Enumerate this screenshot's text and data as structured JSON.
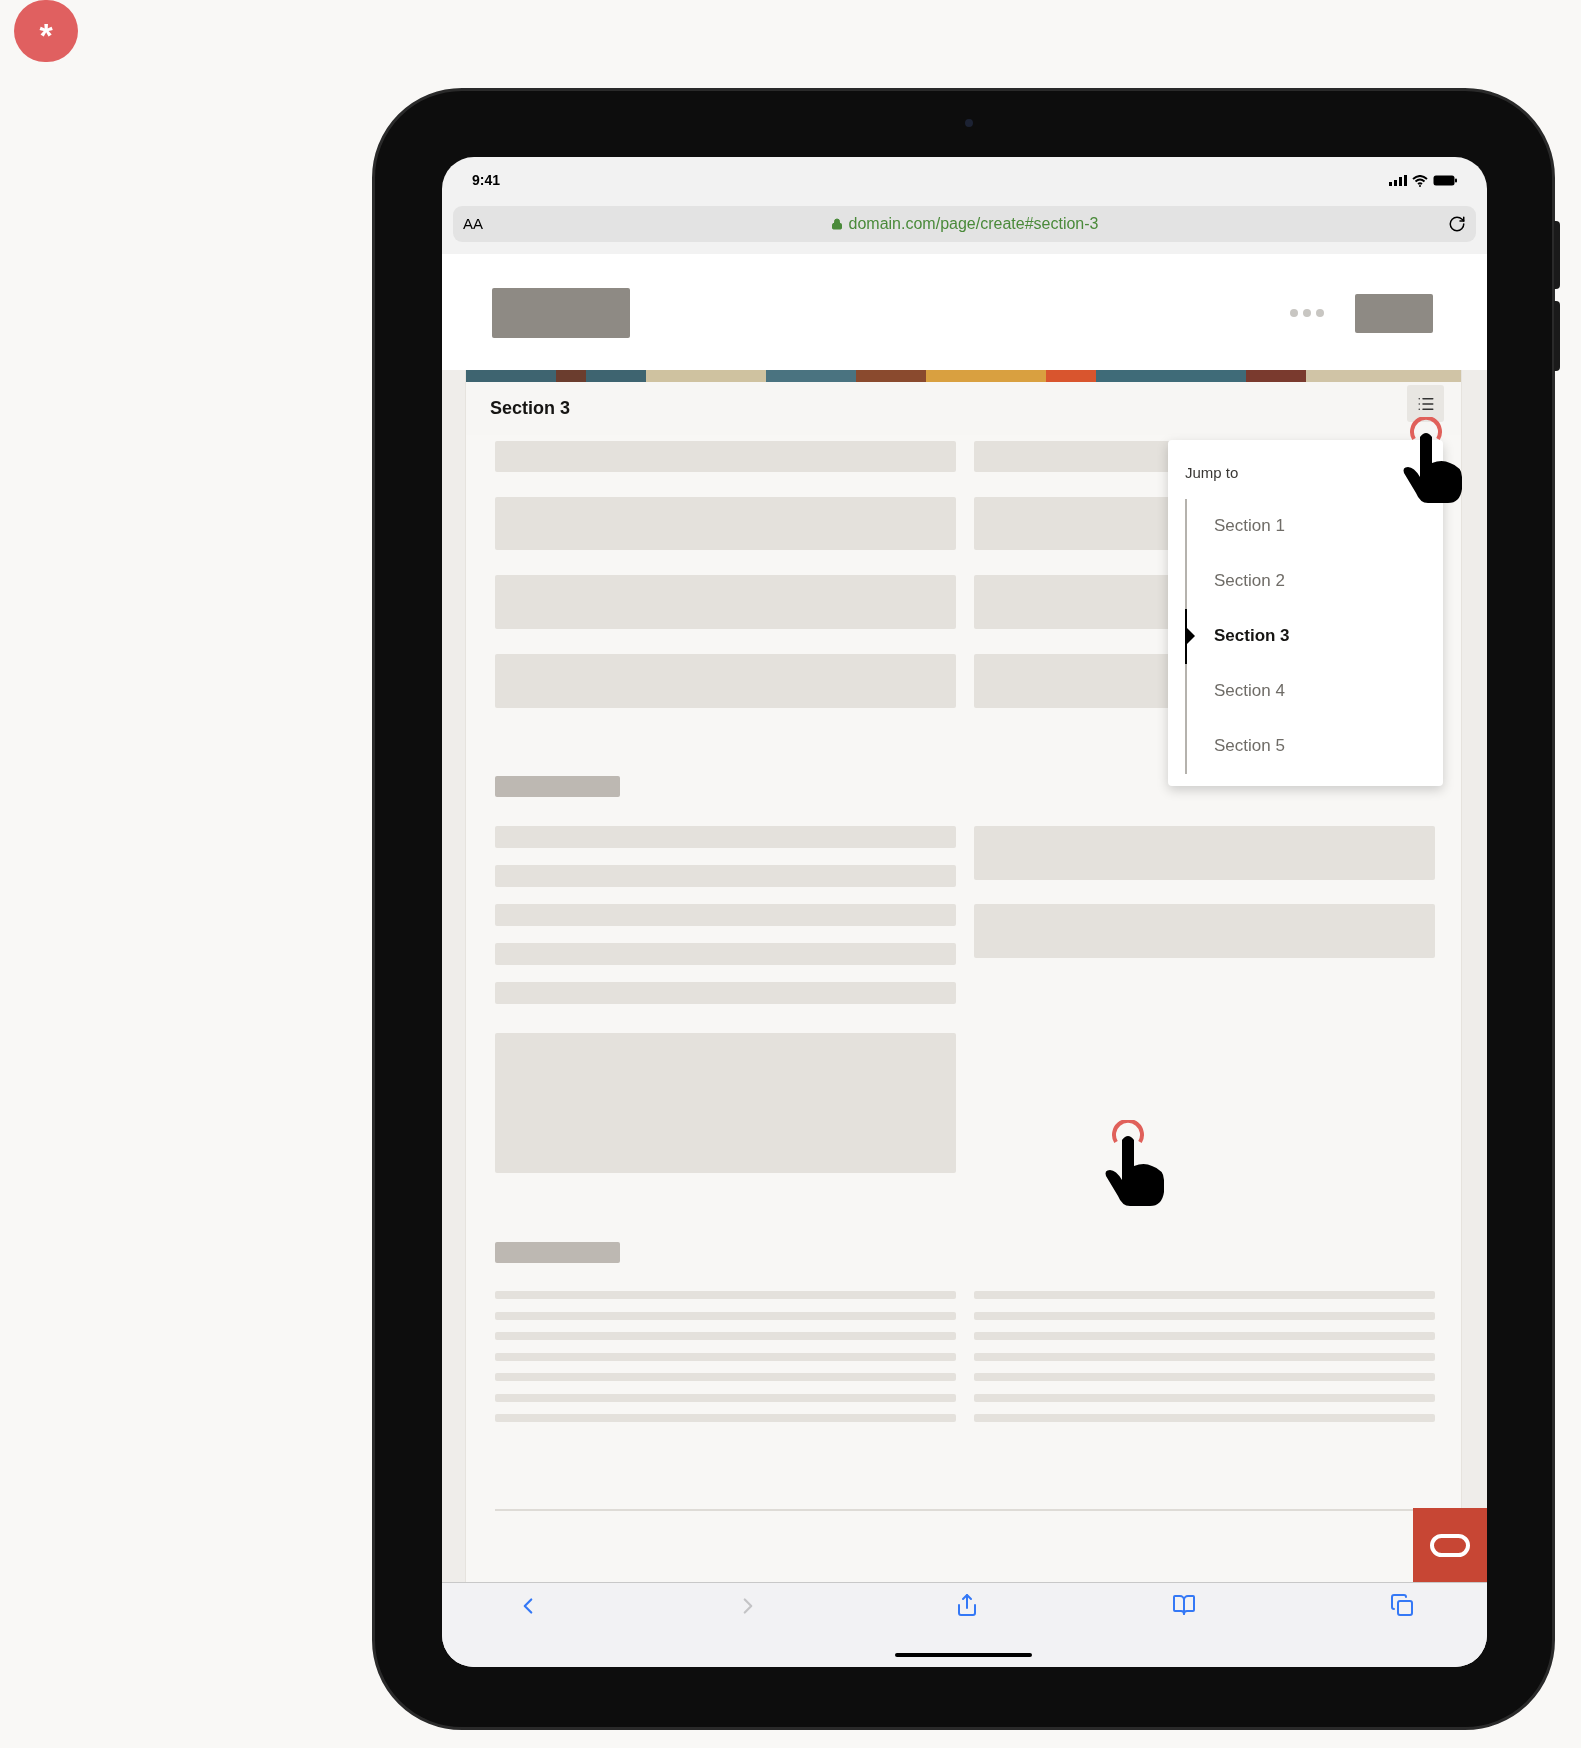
{
  "corner_badge": {
    "symbol": "*"
  },
  "status_bar": {
    "time": "9:41"
  },
  "address_bar": {
    "text_size": "AA",
    "url": "domain.com/page/create#section-3"
  },
  "section_header": {
    "title": "Section 3"
  },
  "jump_menu": {
    "title": "Jump to",
    "items": [
      {
        "label": "Section 1",
        "selected": false
      },
      {
        "label": "Section 2",
        "selected": false
      },
      {
        "label": "Section 3",
        "selected": true
      },
      {
        "label": "Section 4",
        "selected": false
      },
      {
        "label": "Section 5",
        "selected": false
      }
    ]
  }
}
